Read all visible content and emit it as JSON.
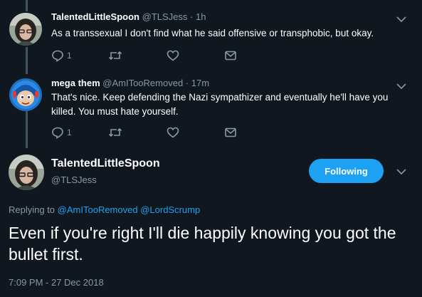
{
  "replies": [
    {
      "display_name": "TalentedLittleSpoon",
      "handle": "@TLSJess",
      "separator": "·",
      "time": "1h",
      "text": "As a transsexual I don't find what he said offensive or transphobic, but okay.",
      "reply_count": "1",
      "retweet_count": "",
      "like_count": ""
    },
    {
      "display_name": "mega them",
      "handle": "@AmITooRemoved",
      "separator": "·",
      "time": "17m",
      "text": "That's nice. Keep defending the Nazi sympathizer and eventually he'll have you killed. You must hate yourself.",
      "reply_count": "1",
      "retweet_count": "",
      "like_count": ""
    }
  ],
  "main_tweet": {
    "display_name": "TalentedLittleSpoon",
    "handle": "@TLSJess",
    "follow_label": "Following",
    "replying_prefix": "Replying to",
    "replying_to": [
      "@AmITooRemoved",
      "@LordScrump"
    ],
    "text": "Even if you're right I'll die happily knowing you got the bullet first.",
    "timestamp": "7:09 PM - 27 Dec 2018"
  },
  "colors": {
    "background": "#10171e",
    "accent": "#1da1f2",
    "muted": "#8899a6",
    "thread_line": "#3d5466"
  },
  "icons": [
    "reply-icon",
    "retweet-icon",
    "like-icon",
    "dm-icon",
    "chevron-down-icon"
  ]
}
